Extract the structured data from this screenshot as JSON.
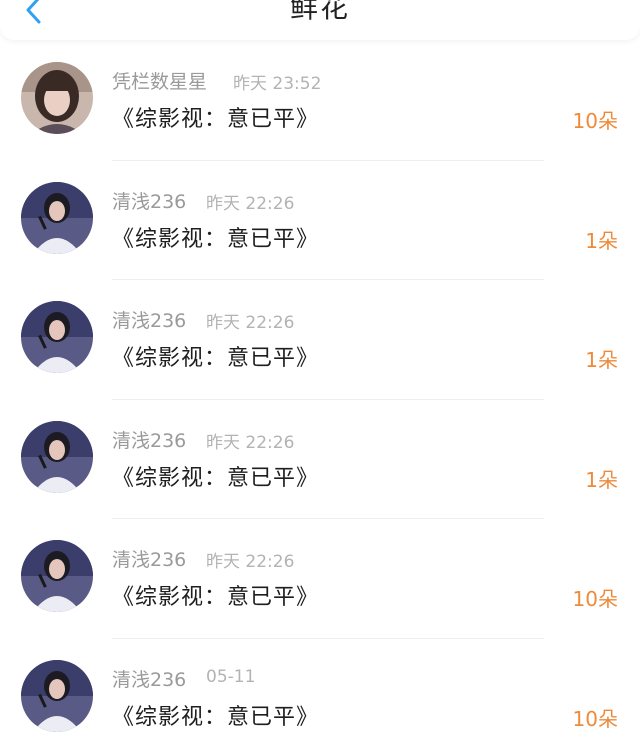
{
  "header": {
    "title": "鲜花"
  },
  "colors": {
    "accent": "#2ea1f3",
    "count": "#ee8a3a"
  },
  "records": [
    {
      "user": "凭栏数星星",
      "time": "昨天 23:52",
      "book": "《综影视：意已平》",
      "count": "10朵",
      "avatar": "woman-icon"
    },
    {
      "user": "清浅236",
      "time": "昨天 22:26",
      "book": "《综影视：意已平》",
      "count": "1朵",
      "avatar": "singer-icon"
    },
    {
      "user": "清浅236",
      "time": "昨天 22:26",
      "book": "《综影视：意已平》",
      "count": "1朵",
      "avatar": "singer-icon"
    },
    {
      "user": "清浅236",
      "time": "昨天 22:26",
      "book": "《综影视：意已平》",
      "count": "1朵",
      "avatar": "singer-icon"
    },
    {
      "user": "清浅236",
      "time": "昨天 22:26",
      "book": "《综影视：意已平》",
      "count": "10朵",
      "avatar": "singer-icon"
    },
    {
      "user": "清浅236",
      "time": "05-11",
      "book": "《综影视：意已平》",
      "count": "10朵",
      "avatar": "singer-icon"
    }
  ]
}
